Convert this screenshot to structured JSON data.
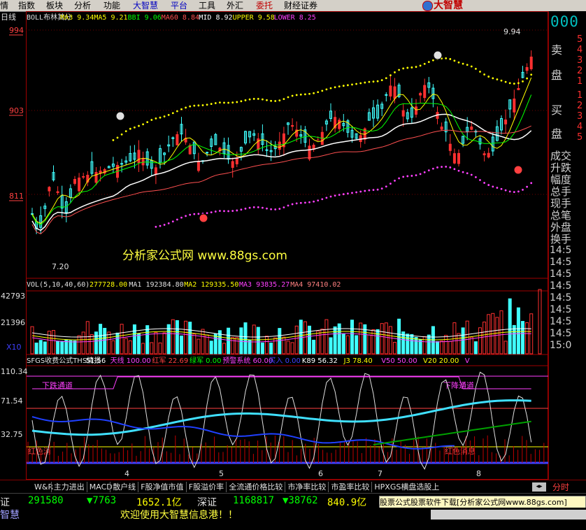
{
  "menu": [
    {
      "label": "情",
      "style": "normal"
    },
    {
      "label": "指数",
      "style": "normal"
    },
    {
      "label": "板块",
      "style": "normal"
    },
    {
      "label": "分析",
      "style": "normal"
    },
    {
      "label": "功能",
      "style": "normal"
    },
    {
      "label": "大智慧",
      "style": "hl"
    },
    {
      "label": "平台",
      "style": "hl"
    },
    {
      "label": "工具",
      "style": "normal"
    },
    {
      "label": "外汇",
      "style": "normal"
    },
    {
      "label": "委托",
      "style": "red"
    },
    {
      "label": "财经证券",
      "style": "normal"
    }
  ],
  "brand": "大智慧",
  "main_chart": {
    "period": "日线",
    "indicator_line": [
      {
        "text": "BOLL布林其分",
        "color": "#e0e0e0"
      },
      {
        "text": "MA3 9.34",
        "color": "#ffff00"
      },
      {
        "text": "MA5 9.21",
        "color": "#ffff00"
      },
      {
        "text": "BBI 9.06",
        "color": "#00ff00"
      },
      {
        "text": "MA60 8.84",
        "color": "#ff5050"
      },
      {
        "text": "MID 8.92",
        "color": "#ffffff"
      },
      {
        "text": "UPPER 9.58",
        "color": "#ffff00"
      },
      {
        "text": "LOWER 8.25",
        "color": "#ff40ff"
      }
    ],
    "y_ticks": [
      "994",
      "903",
      "811"
    ],
    "high_label": "9.94",
    "low_label": "7.20",
    "watermark": "分析家公式网 www.88gs.com"
  },
  "volume_panel": {
    "title": "VOL(5,10,40,60)",
    "values": [
      {
        "text": "277728.00",
        "color": "#ffff00"
      },
      {
        "text": "MA1 192384.80",
        "color": "#e0e0e0"
      },
      {
        "text": "MA2 129335.50",
        "color": "#ffff00"
      },
      {
        "text": "MA3 93835.27",
        "color": "#ff40ff"
      },
      {
        "text": "MA4 97410.02",
        "color": "#ff8080"
      }
    ],
    "y_ticks": [
      "42793",
      "21396"
    ],
    "unit": "X10"
  },
  "sub_panel": {
    "title": "SFGS收费公式THS情报",
    "values": [
      {
        "text": "51.56",
        "color": "#ffffff"
      },
      {
        "text": "天线 100.00",
        "color": "#ff40ff"
      },
      {
        "text": "红军 22.69",
        "color": "#ff4040"
      },
      {
        "text": "绿军 0.00",
        "color": "#00ff00"
      },
      {
        "text": "预警系统 60.00",
        "color": "#ff40ff"
      },
      {
        "text": "买入 0.00",
        "color": "#4040ff"
      },
      {
        "text": "K89 56.32",
        "color": "#ffffff"
      },
      {
        "text": "J3 78.40",
        "color": "#ffff00"
      },
      {
        "text": "V50 50.00",
        "color": "#ff40ff"
      },
      {
        "text": "V20 20.00",
        "color": "#ffff00"
      },
      {
        "text": "V",
        "color": "#ff40ff"
      }
    ],
    "y_ticks": [
      "110.34",
      "71.54",
      "32.75"
    ],
    "label_top_left": "下跌通道",
    "label_top_right": "下降通道",
    "label_bot_left": "红色消",
    "label_bot_right": "红色消息"
  },
  "x_labels": [
    "4",
    "5",
    "6",
    "7",
    "8"
  ],
  "right_panel": {
    "quote_digits": "000",
    "sell_label": "卖",
    "sell_label2": "盘",
    "buy_label": "买",
    "buy_label2": "盘",
    "sell_levels": [
      "5",
      "4",
      "3",
      "2",
      "1"
    ],
    "buy_levels": [
      "1",
      "2",
      "3",
      "4",
      "5"
    ],
    "fields": [
      "成交",
      "升跌",
      "幅度",
      "总手",
      "现手",
      "总笔",
      "外盘",
      "换手"
    ],
    "times": [
      "14:5",
      "14:5",
      "14:5",
      "14:5",
      "14:5",
      "14:5",
      "14:5",
      "14:5",
      "15:0"
    ]
  },
  "tabs": [
    "W&R",
    "主力进出",
    "MACD",
    "散户线",
    "F股净值市值",
    "F股溢价率",
    "全流通价格比较",
    "市净率比较",
    "市盈率比较",
    "HPXGS横盘选股上"
  ],
  "tab_period": "分时",
  "statusbar": [
    {
      "text": "证",
      "color": "#e0e0e0"
    },
    {
      "text": "291580",
      "color": "#00ff00"
    },
    {
      "text": "▼7763",
      "color": "#00ff00"
    },
    {
      "text": "1652.1亿",
      "color": "#ffff00"
    },
    {
      "text": "深证",
      "color": "#e0e0e0"
    },
    {
      "text": "1168817",
      "color": "#00ff00"
    },
    {
      "text": "▼38762",
      "color": "#00ff00"
    },
    {
      "text": "840.9亿",
      "color": "#ffff00"
    }
  ],
  "ad": "股票公式股票软件下载[分析家公式网www.88gs.com]",
  "ticker_left": "智慧",
  "ticker_msg": "欢迎使用大智慧信息港！！"
}
